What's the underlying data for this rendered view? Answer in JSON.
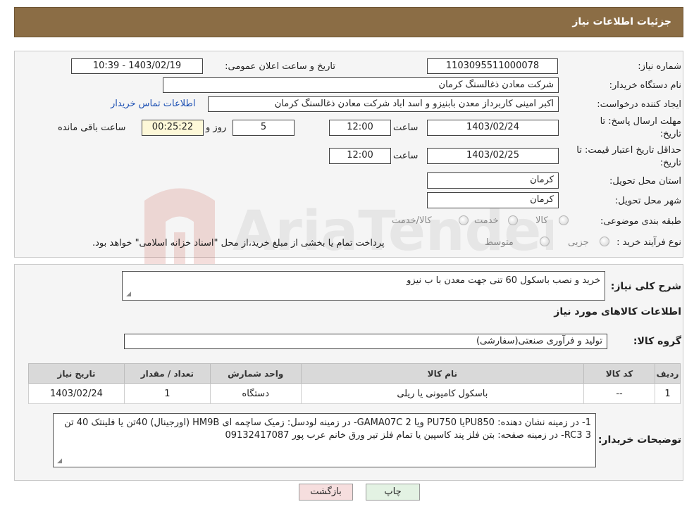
{
  "header": {
    "title": "جزئیات اطلاعات نیاز"
  },
  "form": {
    "need_number": {
      "label": "شماره نیاز:",
      "value": "1103095511000078"
    },
    "announce_datetime": {
      "label": "تاریخ و ساعت اعلان عمومی:",
      "value": "1403/02/19 - 10:39"
    },
    "buyer_org": {
      "label": "نام دستگاه خریدار:",
      "value": "شرکت معادن ذغالسنگ کرمان"
    },
    "requester": {
      "label": "ایجاد کننده درخواست:",
      "value": "اکبر امینی کاربرداز معدن بابنیزو و اسد اباد شرکت معادن ذغالسنگ کرمان",
      "contact_link": "اطلاعات تماس خریدار"
    },
    "reply_deadline": {
      "label": "مهلت ارسال پاسخ: تا تاریخ:",
      "date": "1403/02/24",
      "time_label": "ساعت",
      "time": "12:00",
      "days": "5",
      "days_label": "روز و",
      "remaining": "00:25:22",
      "remaining_label": "ساعت باقی مانده"
    },
    "price_validity": {
      "label": "حداقل تاریخ اعتبار قیمت: تا تاریخ:",
      "date": "1403/02/25",
      "time_label": "ساعت",
      "time": "12:00"
    },
    "delivery_province": {
      "label": "استان محل تحویل:",
      "value": "کرمان"
    },
    "delivery_city": {
      "label": "شهر محل تحویل:",
      "value": "کرمان"
    },
    "category": {
      "label": "طبقه بندی موضوعی:",
      "options": [
        "کالا",
        "خدمت",
        "کالا/خدمت"
      ]
    },
    "purchase_type": {
      "label": "نوع فرآیند خرید :",
      "options": [
        "جزیی",
        "متوسط"
      ],
      "note": "پرداخت تمام یا بخشی از مبلغ خرید،از محل \"اسناد خزانه اسلامی\" خواهد بود."
    }
  },
  "details": {
    "summary_label": "شرح کلی نیاز:",
    "summary": "خرید و نصب باسکول 60 تنی جهت معدن با ب نیزو",
    "goods_title": "اطلاعات کالاهای مورد نیاز",
    "group_label": "گروه کالا:",
    "group": "تولید و فرآوری صنعتی(سفارشی)",
    "table": {
      "headers": [
        "ردیف",
        "کد کالا",
        "نام کالا",
        "واحد شمارش",
        "تعداد / مقدار",
        "تاریخ نیاز"
      ],
      "rows": [
        [
          "1",
          "--",
          "باسکول کامیونی یا ریلی",
          "دستگاه",
          "1",
          "1403/02/24"
        ]
      ]
    },
    "buyer_notes_label": "توضیحات خریدار:",
    "buyer_notes": "1- در زمینه نشان دهنده: PU850یا PU750 ویا GAMA07C 2- در زمینه لودسل: زمیک ساچمه ای HM9B (اورجینال) 40تن یا فلینتک 40 تن 3 RC3- در زمینه صفحه: بتن فلز پند کاسپین یا تمام فلز تیر ورق خانم عرب پور 09132417087"
  },
  "buttons": {
    "print": "چاپ",
    "back": "بازگشت"
  },
  "colors": {
    "header": "#8b6d45",
    "link": "#1b4fb3",
    "back_button": "#f6dede",
    "print_button": "#e3f2e3"
  }
}
